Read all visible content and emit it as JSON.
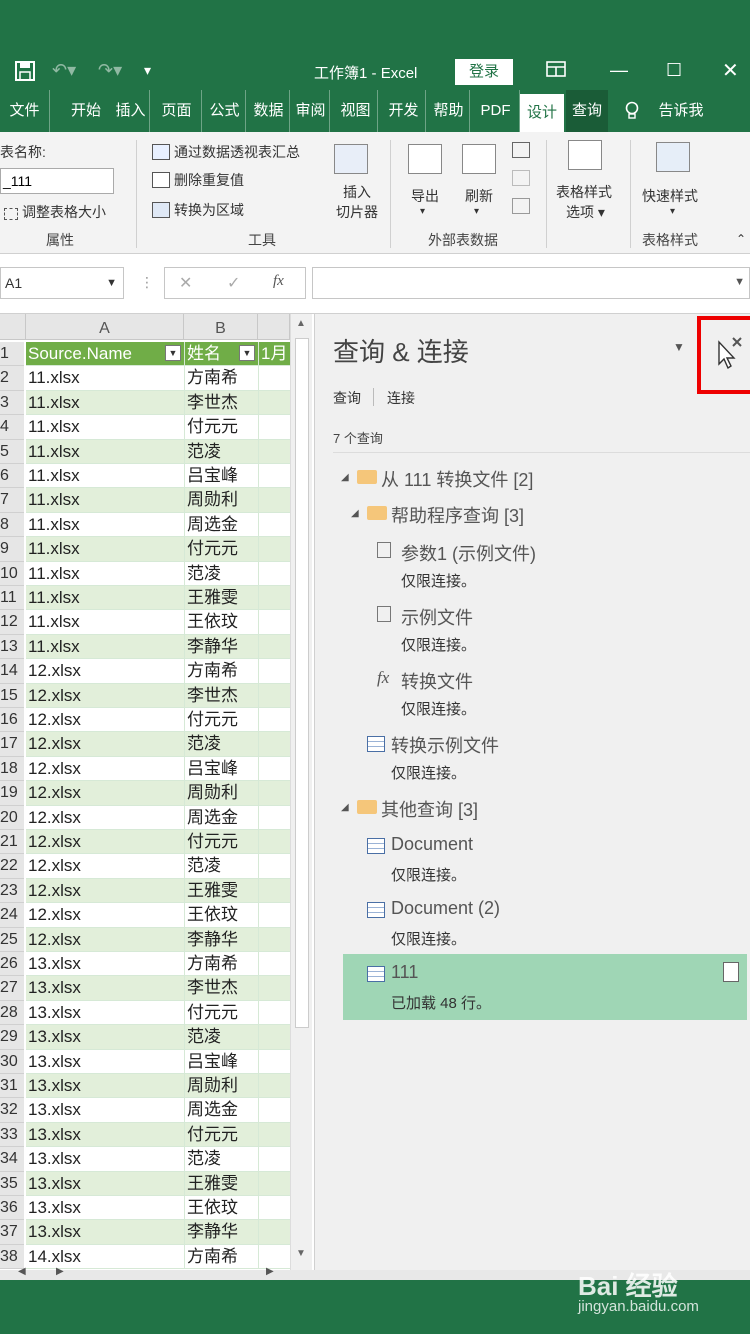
{
  "title": {
    "workbook": "工作簿1",
    "separator": "-",
    "app": "Excel",
    "login": "登录"
  },
  "tabs": [
    {
      "label": "文件"
    },
    {
      "label": "开始"
    },
    {
      "label": "插入"
    },
    {
      "label": "页面"
    },
    {
      "label": "公式"
    },
    {
      "label": "数据"
    },
    {
      "label": "审阅"
    },
    {
      "label": "视图"
    },
    {
      "label": "开发"
    },
    {
      "label": "帮助"
    },
    {
      "label": "PDF"
    },
    {
      "label": "设计"
    },
    {
      "label": "查询"
    },
    {
      "label": "告诉我"
    }
  ],
  "ribbon": {
    "table_name_label": "表名称:",
    "table_name_value": "_111",
    "resize": "调整表格大小",
    "group_properties": "属性",
    "pivot": "通过数据透视表汇总",
    "dedupe": "删除重复值",
    "convert": "转换为区域",
    "slicer_1": "插入",
    "slicer_2": "切片器",
    "group_tools": "工具",
    "export": "导出",
    "refresh": "刷新",
    "group_external": "外部表数据",
    "style_options_1": "表格样式",
    "style_options_2": "选项",
    "quick_style": "快速样式",
    "group_styles": "表格样式"
  },
  "formula": {
    "name_box": "A1",
    "cancel": "✕",
    "enter": "✓",
    "fx": "fx"
  },
  "sheet": {
    "col_a": "A",
    "col_b": "B",
    "header": {
      "a": "Source.Name",
      "b": "姓名",
      "c": "1月"
    },
    "rows": [
      {
        "n": "2",
        "a": "11.xlsx",
        "b": "方南希"
      },
      {
        "n": "3",
        "a": "11.xlsx",
        "b": "李世杰"
      },
      {
        "n": "4",
        "a": "11.xlsx",
        "b": "付元元"
      },
      {
        "n": "5",
        "a": "11.xlsx",
        "b": "范凌"
      },
      {
        "n": "6",
        "a": "11.xlsx",
        "b": "吕宝峰"
      },
      {
        "n": "7",
        "a": "11.xlsx",
        "b": "周勋利"
      },
      {
        "n": "8",
        "a": "11.xlsx",
        "b": "周选金"
      },
      {
        "n": "9",
        "a": "11.xlsx",
        "b": "付元元"
      },
      {
        "n": "10",
        "a": "11.xlsx",
        "b": "范凌"
      },
      {
        "n": "11",
        "a": "11.xlsx",
        "b": "王雅雯"
      },
      {
        "n": "12",
        "a": "11.xlsx",
        "b": "王依玟"
      },
      {
        "n": "13",
        "a": "11.xlsx",
        "b": "李静华"
      },
      {
        "n": "14",
        "a": "12.xlsx",
        "b": "方南希"
      },
      {
        "n": "15",
        "a": "12.xlsx",
        "b": "李世杰"
      },
      {
        "n": "16",
        "a": "12.xlsx",
        "b": "付元元"
      },
      {
        "n": "17",
        "a": "12.xlsx",
        "b": "范凌"
      },
      {
        "n": "18",
        "a": "12.xlsx",
        "b": "吕宝峰"
      },
      {
        "n": "19",
        "a": "12.xlsx",
        "b": "周勋利"
      },
      {
        "n": "20",
        "a": "12.xlsx",
        "b": "周选金"
      },
      {
        "n": "21",
        "a": "12.xlsx",
        "b": "付元元"
      },
      {
        "n": "22",
        "a": "12.xlsx",
        "b": "范凌"
      },
      {
        "n": "23",
        "a": "12.xlsx",
        "b": "王雅雯"
      },
      {
        "n": "24",
        "a": "12.xlsx",
        "b": "王依玟"
      },
      {
        "n": "25",
        "a": "12.xlsx",
        "b": "李静华"
      },
      {
        "n": "26",
        "a": "13.xlsx",
        "b": "方南希"
      },
      {
        "n": "27",
        "a": "13.xlsx",
        "b": "李世杰"
      },
      {
        "n": "28",
        "a": "13.xlsx",
        "b": "付元元"
      },
      {
        "n": "29",
        "a": "13.xlsx",
        "b": "范凌"
      },
      {
        "n": "30",
        "a": "13.xlsx",
        "b": "吕宝峰"
      },
      {
        "n": "31",
        "a": "13.xlsx",
        "b": "周勋利"
      },
      {
        "n": "32",
        "a": "13.xlsx",
        "b": "周选金"
      },
      {
        "n": "33",
        "a": "13.xlsx",
        "b": "付元元"
      },
      {
        "n": "34",
        "a": "13.xlsx",
        "b": "范凌"
      },
      {
        "n": "35",
        "a": "13.xlsx",
        "b": "王雅雯"
      },
      {
        "n": "36",
        "a": "13.xlsx",
        "b": "王依玟"
      },
      {
        "n": "37",
        "a": "13.xlsx",
        "b": "李静华"
      },
      {
        "n": "38",
        "a": "14.xlsx",
        "b": "方南希"
      }
    ]
  },
  "pane": {
    "title": "查询 & 连接",
    "tab_queries": "查询",
    "tab_connections": "连接",
    "count": "7 个查询",
    "group1": "从 111 转换文件 [2]",
    "group1_sub": "帮助程序查询 [3]",
    "q1": {
      "name": "参数1 (示例文件)",
      "status": "仅限连接。"
    },
    "q2": {
      "name": "示例文件",
      "status": "仅限连接。"
    },
    "q3": {
      "name": "转换文件",
      "status": "仅限连接。"
    },
    "q4": {
      "name": "转换示例文件",
      "status": "仅限连接。"
    },
    "group2": "其他查询 [3]",
    "q5": {
      "name": "Document",
      "status": "仅限连接。"
    },
    "q6": {
      "name": "Document (2)",
      "status": "仅限连接。"
    },
    "q7": {
      "name": "111",
      "status": "已加载 48 行。"
    }
  },
  "watermark": {
    "brand": "Bai 经验",
    "url": "jingyan.baidu.com"
  },
  "colors": {
    "excel_green": "#217346",
    "table_header": "#70ad47",
    "band": "#e2efda",
    "selected": "#9fd6b5",
    "highlight": "#ee0000"
  }
}
